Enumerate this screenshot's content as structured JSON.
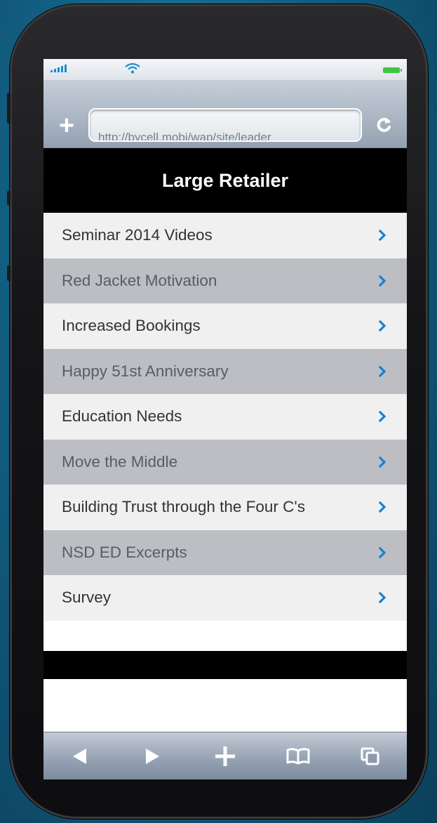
{
  "browser": {
    "url": "http://bycell.mobi/wap/site/leader"
  },
  "page": {
    "title": "Large Retailer"
  },
  "menu": {
    "items": [
      {
        "label": "Seminar 2014 Videos"
      },
      {
        "label": "Red Jacket Motivation"
      },
      {
        "label": "Increased Bookings"
      },
      {
        "label": "Happy 51st Anniversary"
      },
      {
        "label": "Education Needs"
      },
      {
        "label": "Move the Middle"
      },
      {
        "label": "Building Trust through the Four C's"
      },
      {
        "label": "NSD ED Excerpts"
      },
      {
        "label": "Survey"
      }
    ]
  },
  "icons": {
    "signal": "signal-icon",
    "wifi": "wifi-icon",
    "battery": "battery-icon",
    "add_bookmark": "plus-icon",
    "reload": "reload-icon",
    "chevron": "chevron-right-icon",
    "back": "back-arrow-icon",
    "forward": "forward-arrow-icon",
    "add": "plus-icon",
    "bookmarks": "book-icon",
    "pages": "pages-icon"
  },
  "colors": {
    "chevron": "#1d7fcf",
    "header_bg": "#000000",
    "row_light": "#f0f0f0",
    "row_dark": "#bcbec3"
  }
}
